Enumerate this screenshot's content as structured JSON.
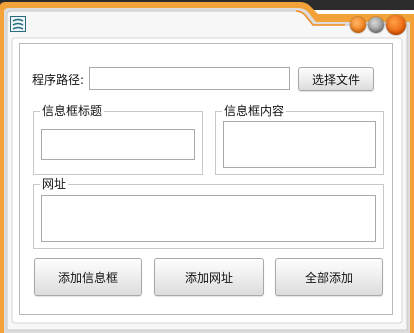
{
  "window": {
    "icon": "app-logo-icon",
    "controls": [
      "minimize-button",
      "maximize-button",
      "close-button"
    ],
    "accent_colors": {
      "orange": "#f08a1c",
      "teal": "#2a6c7d",
      "gray": "#9a9a9a"
    }
  },
  "form": {
    "path_label": "程序路径:",
    "path_value": "",
    "browse_button": "选择文件",
    "infobox_title_group": "信息框标题",
    "infobox_title_value": "",
    "infobox_content_group": "信息框内容",
    "infobox_content_value": "",
    "url_group": "网址",
    "url_value": ""
  },
  "actions": {
    "add_infobox": "添加信息框",
    "add_url": "添加网址",
    "add_all": "全部添加"
  }
}
